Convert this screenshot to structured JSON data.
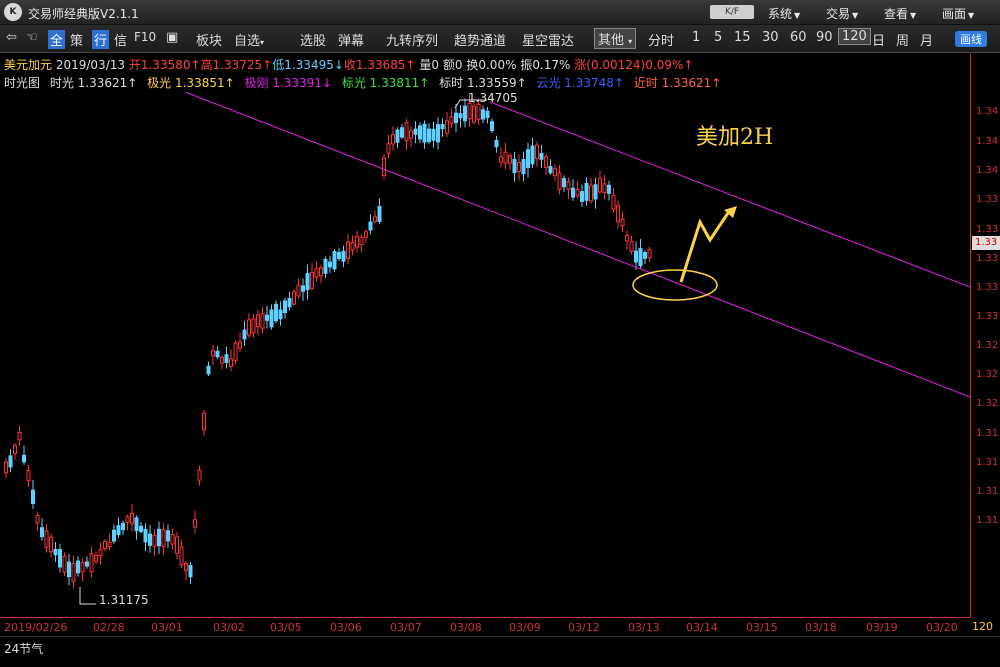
{
  "titlebar": {
    "logo": "K",
    "app_title": "交易师经典版V2.1.1",
    "badge": "K/F",
    "menus": [
      "系统",
      "交易",
      "查看",
      "画面"
    ]
  },
  "toolbar": {
    "items": [
      "全",
      "策",
      "行",
      "信",
      "F10",
      "板块",
      "自选",
      "选股",
      "弹幕",
      "九转序列",
      "趋势通道",
      "星空雷达",
      "其他"
    ],
    "periods": [
      "分时",
      "1",
      "5",
      "15",
      "30",
      "60",
      "90",
      "120",
      "日",
      "周",
      "月"
    ],
    "selected_period": "120",
    "right_button": "画线"
  },
  "quote": {
    "symbol": "美元加元",
    "date": "2019/03/13",
    "open": "开1.33580↑",
    "high": "高1.33725↑",
    "low": "低1.33495↓",
    "close": "收1.33685↑",
    "volume": "量0",
    "amount": "额0",
    "turnover": "换0.00%",
    "amplitude": "振0.17%",
    "change": "涨(0.00124)0.09%↑"
  },
  "indicators": {
    "name": "时光图",
    "shiguang": "时光 1.33621↑",
    "jiguang": "极光 1.33851↑",
    "jigang": "极刚 1.33391↓",
    "biaoguang": "标光 1.33811↑",
    "biaoshi": "标时 1.33559↑",
    "yunguang": "云光 1.33748↑",
    "jinshi": "近时 1.33621↑"
  },
  "chart": {
    "annotation": "美加2H",
    "high_label": "1.34705",
    "low_label": "1.31175",
    "price_tag": "1.33",
    "price_ticks": [
      "1.34",
      "1.34",
      "1.34",
      "1.33",
      "1.33",
      "1.33",
      "1.33",
      "1.33",
      "1.32",
      "1.32",
      "1.32",
      "1.31",
      "1.31",
      "1.31",
      "1.31"
    ],
    "dates": [
      "2019/02/26",
      "02/28",
      "03/01",
      "03/02",
      "03/05",
      "03/06",
      "03/07",
      "03/08",
      "03/09",
      "03/12",
      "03/13",
      "03/14",
      "03/15",
      "03/18",
      "03/19",
      "03/20"
    ],
    "corner_label": "120",
    "colors": {
      "up": "#ff3333",
      "down": "#5fd0ff",
      "channel": "#e020e0",
      "annotation": "#ffd24a"
    }
  },
  "bottom": {
    "label": "24节气"
  }
}
